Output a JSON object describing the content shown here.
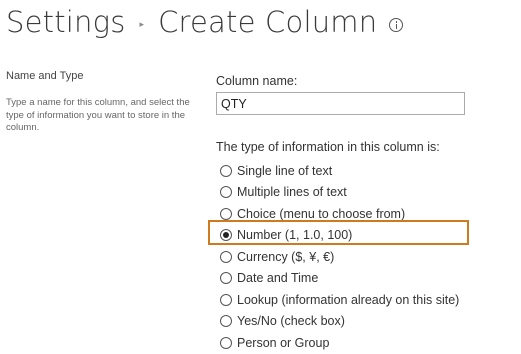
{
  "header": {
    "breadcrumb_parent": "Settings",
    "separator": "▸",
    "page_title": "Create Column"
  },
  "section": {
    "title": "Name and Type",
    "description": "Type a name for this column, and select the type of information you want to store in the column."
  },
  "column_name": {
    "label": "Column name:",
    "value": "QTY"
  },
  "type_group": {
    "label": "The type of information in this column is:",
    "selected_index": 3,
    "options": [
      {
        "label": "Single line of text",
        "checked": false
      },
      {
        "label": "Multiple lines of text",
        "checked": false
      },
      {
        "label": "Choice (menu to choose from)",
        "checked": false
      },
      {
        "label": "Number (1, 1.0, 100)",
        "checked": true
      },
      {
        "label": "Currency ($, ¥, €)",
        "checked": false
      },
      {
        "label": "Date and Time",
        "checked": false
      },
      {
        "label": "Lookup (information already on this site)",
        "checked": false
      },
      {
        "label": "Yes/No (check box)",
        "checked": false
      },
      {
        "label": "Person or Group",
        "checked": false
      }
    ]
  },
  "colors": {
    "highlight_border": "#d07a20",
    "text": "#333333",
    "description_text": "#666666"
  },
  "icons": {
    "info": "info-icon"
  }
}
